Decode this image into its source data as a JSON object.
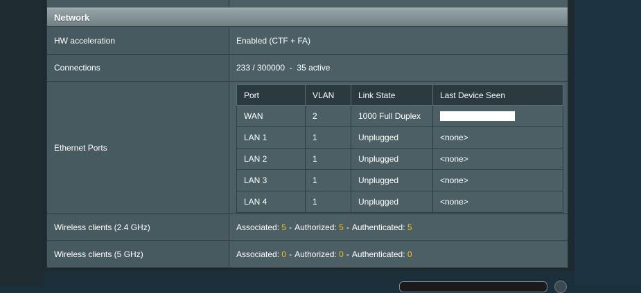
{
  "section": {
    "title": "Network"
  },
  "rows": {
    "hw_accel": {
      "label": "HW acceleration",
      "value": "Enabled (CTF + FA)"
    },
    "connections": {
      "label": "Connections",
      "value": "233 / 300000  -  35 active"
    },
    "ethernet": {
      "label": "Ethernet Ports"
    },
    "wifi24": {
      "label": "Wireless clients (2.4 GHz)",
      "associated_label": "Associated:",
      "associated": "5",
      "authorized_label": "Authorized:",
      "authorized": "5",
      "authenticated_label": "Authenticated:",
      "authenticated": "5"
    },
    "wifi5": {
      "label": "Wireless clients (5 GHz)",
      "associated_label": "Associated:",
      "associated": "0",
      "authorized_label": "Authorized:",
      "authorized": "0",
      "authenticated_label": "Authenticated:",
      "authenticated": "0"
    }
  },
  "ethernet_table": {
    "headers": [
      "Port",
      "VLAN",
      "Link State",
      "Last Device Seen"
    ],
    "rows": [
      {
        "port": "WAN",
        "vlan": "2",
        "link": "1000 Full Duplex",
        "device": ""
      },
      {
        "port": "LAN 1",
        "vlan": "1",
        "link": "Unplugged",
        "device": "<none>"
      },
      {
        "port": "LAN 2",
        "vlan": "1",
        "link": "Unplugged",
        "device": "<none>"
      },
      {
        "port": "LAN 3",
        "vlan": "1",
        "link": "Unplugged",
        "device": "<none>"
      },
      {
        "port": "LAN 4",
        "vlan": "1",
        "link": "Unplugged",
        "device": "<none>"
      }
    ]
  },
  "colors": {
    "accent": "#f2c31a",
    "panel": "#475a5f",
    "header": "#2b3a3f"
  },
  "separator": "-"
}
